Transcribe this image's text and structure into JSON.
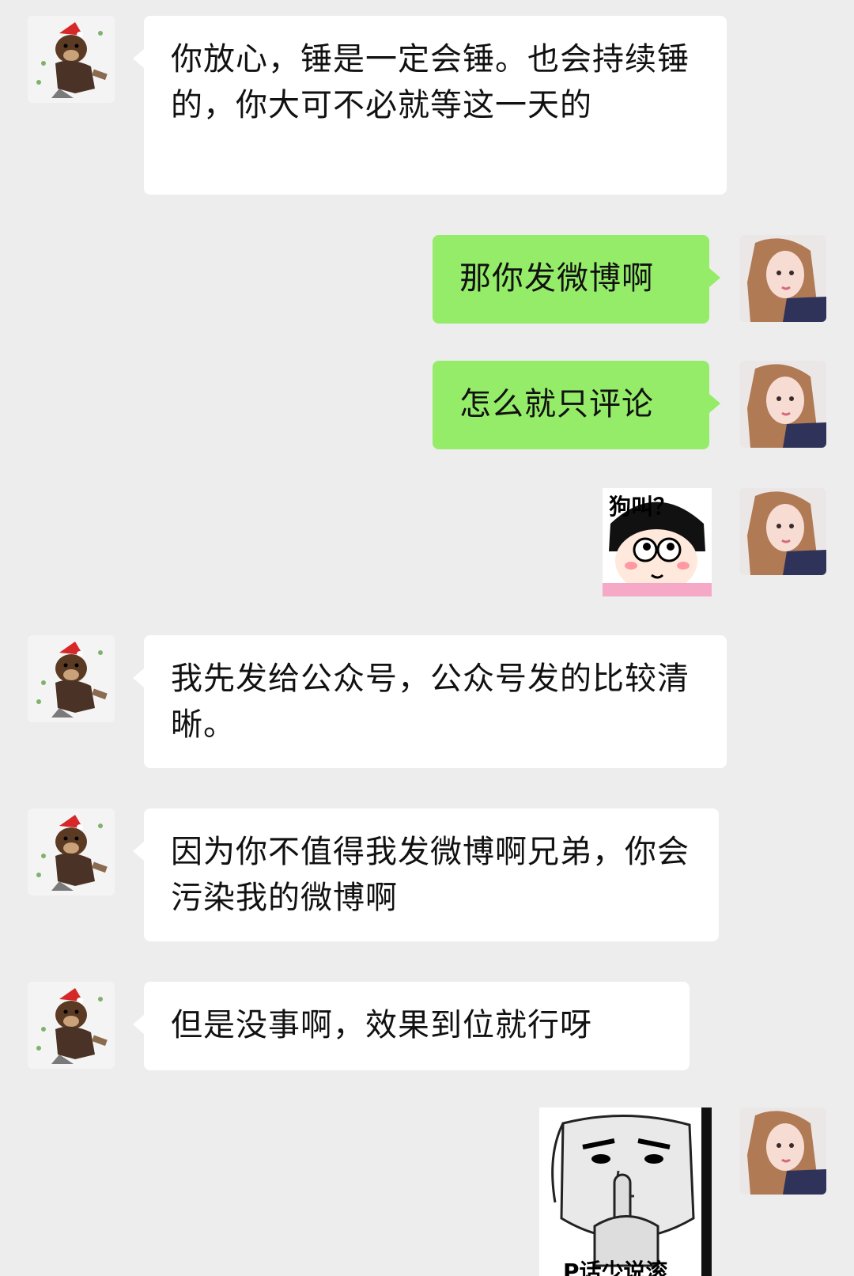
{
  "messages": [
    {
      "side": "left",
      "type": "text",
      "text": "你放心，锤是一定会锤。也会持续锤的，你大可不必就等这一天的"
    },
    {
      "side": "right",
      "type": "text",
      "text": "那你发微博啊"
    },
    {
      "side": "right",
      "type": "text",
      "text": "怎么就只评论"
    },
    {
      "side": "right",
      "type": "sticker",
      "caption": "狗叫？",
      "icon": "girl-cartoon-sticker"
    },
    {
      "side": "left",
      "type": "text",
      "text": "我先发给公众号，公众号发的比较清晰。"
    },
    {
      "side": "left",
      "type": "text",
      "text": "因为你不值得我发微博啊兄弟，你会污染我的微博啊"
    },
    {
      "side": "left",
      "type": "text",
      "text": "但是没事啊，效果到位就行呀"
    },
    {
      "side": "right",
      "type": "sticker",
      "caption": "P话少说滚",
      "icon": "shush-face-sticker"
    }
  ],
  "avatars": {
    "left": "bear-avatar-icon",
    "right": "girl-avatar-icon"
  },
  "colors": {
    "background": "#ededed",
    "incoming_bubble": "#ffffff",
    "outgoing_bubble": "#95ec69"
  }
}
